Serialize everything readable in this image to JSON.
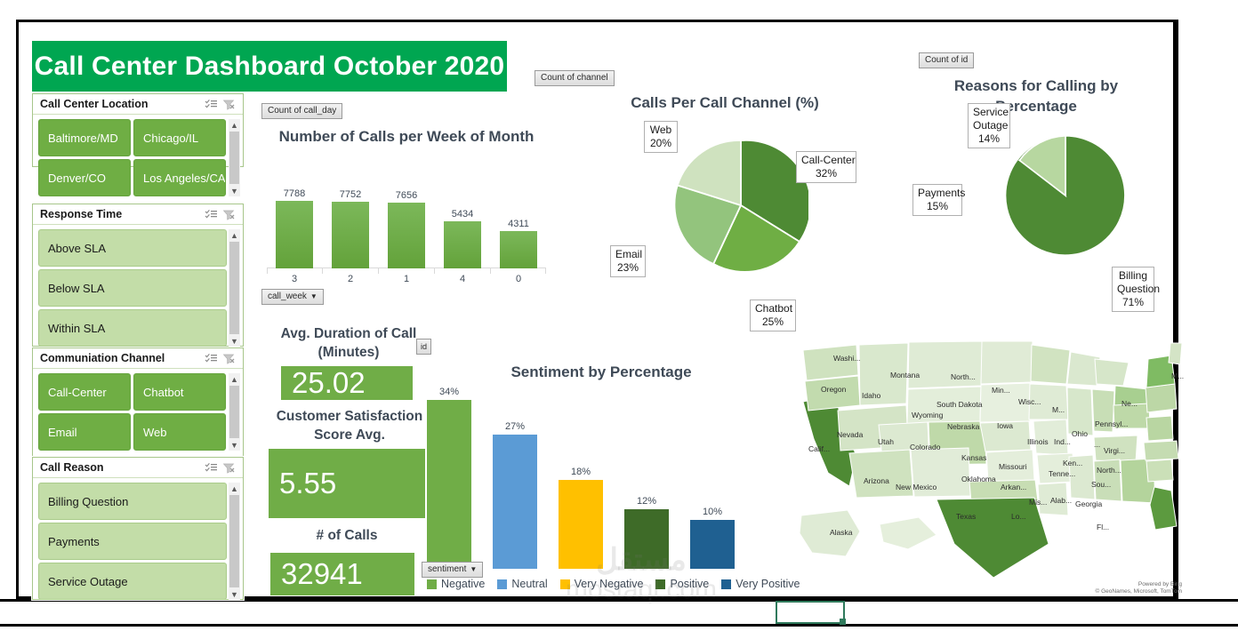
{
  "header": {
    "title": "Call Center Dashboard October 2020",
    "banner_color": "#00A651"
  },
  "slicers": [
    {
      "name": "Call Center Location",
      "multiselect_icon": "multi-select-icon",
      "clear_icon": "clear-filter-icon",
      "items": [
        {
          "label": "Baltimore/MD",
          "state": "selected"
        },
        {
          "label": "Chicago/IL",
          "state": "selected"
        },
        {
          "label": "Denver/CO",
          "state": "selected"
        },
        {
          "label": "Los Angeles/CA",
          "state": "selected"
        }
      ]
    },
    {
      "name": "Response Time",
      "multiselect_icon": "multi-select-icon",
      "clear_icon": "clear-filter-icon",
      "items": [
        {
          "label": "Above SLA",
          "state": "unselected"
        },
        {
          "label": "Below SLA",
          "state": "unselected"
        },
        {
          "label": "Within SLA",
          "state": "unselected"
        }
      ]
    },
    {
      "name": "Communiation Channel",
      "multiselect_icon": "multi-select-icon",
      "clear_icon": "clear-filter-icon",
      "items": [
        {
          "label": "Call-Center",
          "state": "selected"
        },
        {
          "label": "Chatbot",
          "state": "selected"
        },
        {
          "label": "Email",
          "state": "selected"
        },
        {
          "label": "Web",
          "state": "selected"
        }
      ]
    },
    {
      "name": "Call Reason",
      "multiselect_icon": "multi-select-icon",
      "clear_icon": "clear-filter-icon",
      "items": [
        {
          "label": "Billing Question",
          "state": "unselected"
        },
        {
          "label": "Payments",
          "state": "unselected"
        },
        {
          "label": "Service Outage",
          "state": "unselected"
        }
      ]
    }
  ],
  "field_buttons": {
    "calls_per_week_value": "Count of call_day",
    "calls_per_week_axis": "call_week",
    "channel_pie_value": "Count of channel",
    "reasons_pie_value": "Count of id",
    "kpi_id": "id",
    "sentiment_axis": "sentiment"
  },
  "kpis": [
    {
      "label": "Avg. Duration of Call (Minutes)",
      "value": "25.02"
    },
    {
      "label": "Customer Satisfaction Score Avg.",
      "value": "5.55"
    },
    {
      "label": "# of Calls",
      "value": "32941"
    }
  ],
  "map": {
    "credit_line1": "Powered by Bing",
    "credit_line2": "© GeoNames, Microsoft, TomTom",
    "labels": [
      "Washi...",
      "Montana",
      "North...",
      "Min...",
      "M...",
      "Oregon",
      "Idaho",
      "Wisc...",
      "Ne...",
      "South Dakota",
      "M...",
      "Pennsyl...",
      "Wyoming",
      "Nebraska",
      "Iowa",
      "Ohio",
      "Nevada",
      "Utah",
      "Colorado",
      "Illinois",
      "Ind...",
      "Virgi...",
      "Calif...",
      "Kansas",
      "Missouri",
      "Ken...",
      "North...",
      "Arizona",
      "New Mexico",
      "Oklahoma",
      "Tenne...",
      "Sou...",
      "Arkan...",
      "Mis...",
      "Alab...",
      "Georgia",
      "Texas",
      "Lo...",
      "Fl...",
      "Alaska",
      "..."
    ]
  },
  "watermark": {
    "arabic": "مستقل",
    "latin": "mostaql.com"
  },
  "chart_data": [
    {
      "type": "bar",
      "title": "Number of Calls per Week of Month",
      "categories": [
        "3",
        "2",
        "1",
        "4",
        "0"
      ],
      "values": [
        7788,
        7752,
        7656,
        5434,
        4311
      ],
      "xlabel": "call_week",
      "ylabel": "Count of call_day",
      "ylim": [
        0,
        8200
      ],
      "grid": false,
      "legend": "none",
      "series_color": "#70AD47"
    },
    {
      "type": "pie",
      "title": "Calls Per Call Channel (%)",
      "categories": [
        "Call-Center",
        "Chatbot",
        "Email",
        "Web"
      ],
      "values": [
        32,
        25,
        23,
        20
      ],
      "value_suffix": "%",
      "colors": [
        "#4E8A34",
        "#6FAE44",
        "#93C47D",
        "#CFE2BF"
      ],
      "legend": "callouts"
    },
    {
      "type": "pie",
      "title": "Reasons for Calling by Percentage",
      "categories": [
        "Billing Question",
        "Payments",
        "Service Outage"
      ],
      "values": [
        71,
        15,
        14
      ],
      "value_suffix": "%",
      "colors": [
        "#4E8A34",
        "#6FAE44",
        "#B7D7A0"
      ],
      "legend": "callouts"
    },
    {
      "type": "bar",
      "title": "Sentiment by Percentage",
      "categories": [
        "Negative",
        "Neutral",
        "Very Negative",
        "Positive",
        "Very Positive"
      ],
      "values": [
        34,
        27,
        18,
        12,
        10
      ],
      "value_suffix": "%",
      "colors": [
        "#70AD47",
        "#5B9BD5",
        "#FFC000",
        "#3E6B28",
        "#1F6091"
      ],
      "xlabel": "sentiment",
      "ylim": [
        0,
        38
      ],
      "grid": false,
      "legend": "bottom"
    }
  ],
  "chart_labels": {
    "bar1_values": [
      "7788",
      "7752",
      "7656",
      "5434",
      "4311"
    ],
    "bar1_cats": [
      "3",
      "2",
      "1",
      "4",
      "0"
    ],
    "pie1": [
      {
        "name": "Call-Center",
        "pct": "32%"
      },
      {
        "name": "Chatbot",
        "pct": "25%"
      },
      {
        "name": "Email",
        "pct": "23%"
      },
      {
        "name": "Web",
        "pct": "20%"
      }
    ],
    "pie2": [
      {
        "name": "Service Outage",
        "pct": "14%"
      },
      {
        "name": "Payments",
        "pct": "15%"
      },
      {
        "name": "Billing Question",
        "pct": "71%"
      }
    ],
    "bar2_values": [
      "34%",
      "27%",
      "18%",
      "12%",
      "10%"
    ],
    "bar2_cats": [
      "Negative",
      "Neutral",
      "Very Negative",
      "Positive",
      "Very Positive"
    ],
    "titles": {
      "bar1": "Number of Calls per Week of Month",
      "pie1": "Calls Per Call Channel (%)",
      "pie2": "Reasons for Calling by Percentage",
      "bar2": "Sentiment by Percentage"
    }
  }
}
